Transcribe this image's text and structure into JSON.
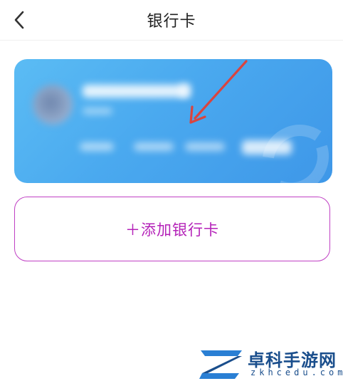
{
  "header": {
    "title": "银行卡",
    "back_icon": "chevron-left-icon"
  },
  "card": {
    "status": "blurred",
    "gradient": [
      "#5bbcf4",
      "#3e97e8"
    ],
    "annotation": "red-arrow"
  },
  "add_card": {
    "label": "＋添加银行卡",
    "accent": "#b421b8"
  },
  "watermark": {
    "name": "卓科手游网",
    "url": "zkhcedu.com"
  }
}
